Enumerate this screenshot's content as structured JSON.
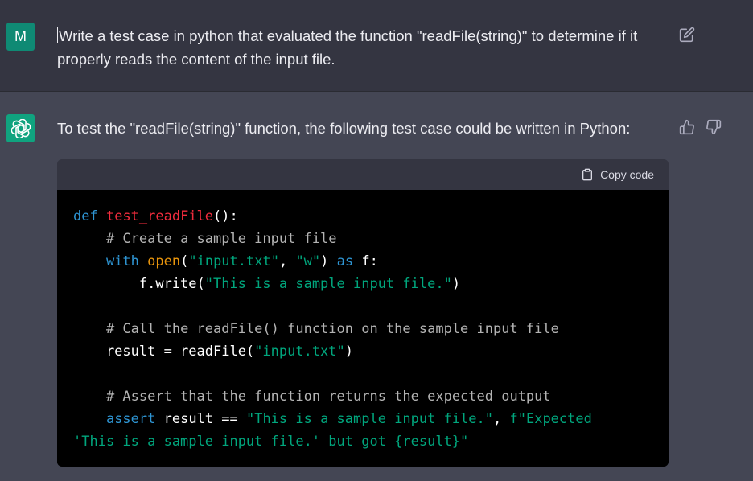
{
  "user": {
    "avatar_letter": "M",
    "message": "Write a test case in python that evaluated the function \"readFile(string)\" to determine if it properly reads the content of the input file.",
    "edit_icon": "edit-icon"
  },
  "assistant": {
    "intro": "To test the \"readFile(string)\" function, the following test case could be written in Python:",
    "feedback_icons": [
      "thumbs-up-icon",
      "thumbs-down-icon"
    ],
    "code": {
      "copy_label": "Copy code",
      "lines": [
        "def test_readFile():",
        "    # Create a sample input file",
        "    with open(\"input.txt\", \"w\") as f:",
        "        f.write(\"This is a sample input file.\")",
        "",
        "    # Call the readFile() function on the sample input file",
        "    result = readFile(\"input.txt\")",
        "",
        "    # Assert that the function returns the expected output",
        "    assert result == \"This is a sample input file.\", f\"Expected 'This is a sample input file.' but got {result}\""
      ]
    }
  },
  "colors": {
    "user_bg": "#343541",
    "assistant_bg": "#444654",
    "avatar_user": "#0f8a74",
    "avatar_gpt": "#10a37f",
    "keyword": "#2e95d3",
    "function_name": "#f22c3d",
    "builtin": "#e9950c",
    "string": "#00a67d",
    "comment": "#b3b3b3"
  }
}
